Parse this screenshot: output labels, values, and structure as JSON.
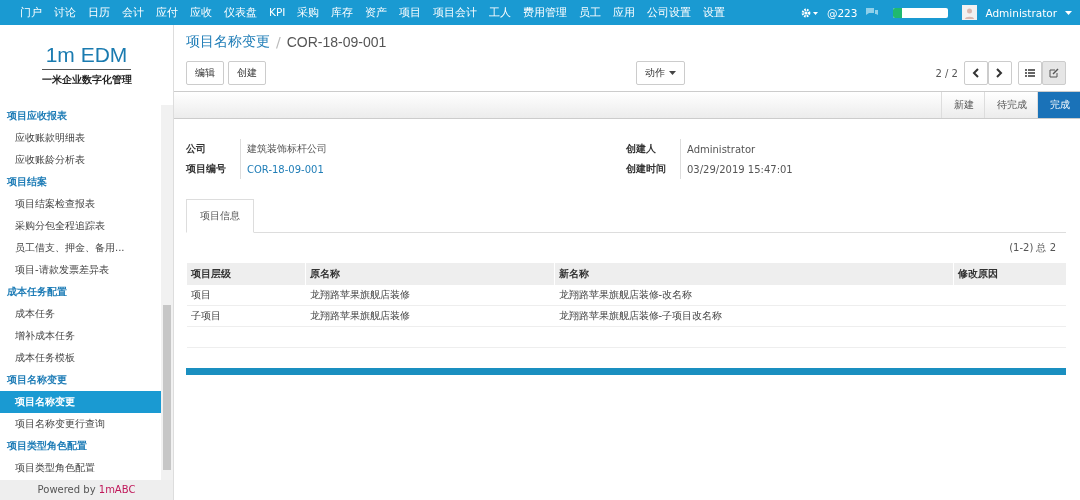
{
  "top_menu": [
    {
      "label": "门户"
    },
    {
      "label": "讨论"
    },
    {
      "label": "日历"
    },
    {
      "label": "会计"
    },
    {
      "label": "应付"
    },
    {
      "label": "应收"
    },
    {
      "label": "仪表盘"
    },
    {
      "label": "KPI"
    },
    {
      "label": "采购"
    },
    {
      "label": "库存"
    },
    {
      "label": "资产"
    },
    {
      "label": "项目"
    },
    {
      "label": "项目会计"
    },
    {
      "label": "工人"
    },
    {
      "label": "费用管理"
    },
    {
      "label": "员工"
    },
    {
      "label": "应用"
    },
    {
      "label": "公司设置"
    },
    {
      "label": "设置"
    }
  ],
  "top_right": {
    "mentions": "@223",
    "meter": {
      "level": 0.15
    },
    "user": "Administrator"
  },
  "logo": {
    "title": "1m EDM",
    "subtitle": "一米企业数字化管理"
  },
  "sidebar": [
    {
      "title": "项目应收报表",
      "items": [
        {
          "label": "应收账款明细表",
          "selected": false
        },
        {
          "label": "应收账龄分析表",
          "selected": false
        }
      ]
    },
    {
      "title": "项目结案",
      "items": [
        {
          "label": "项目结案检查报表",
          "selected": false
        },
        {
          "label": "采购分包全程追踪表",
          "selected": false
        },
        {
          "label": "员工借支、押金、备用...",
          "selected": false
        },
        {
          "label": "项目-请款发票差异表",
          "selected": false
        }
      ]
    },
    {
      "title": "成本任务配置",
      "items": [
        {
          "label": "成本任务",
          "selected": false
        },
        {
          "label": "增补成本任务",
          "selected": false
        },
        {
          "label": "成本任务模板",
          "selected": false
        }
      ]
    },
    {
      "title": "项目名称变更",
      "items": [
        {
          "label": "项目名称变更",
          "selected": true
        },
        {
          "label": "项目名称变更行查询",
          "selected": false
        }
      ]
    },
    {
      "title": "项目类型角色配置",
      "items": [
        {
          "label": "项目类型角色配置",
          "selected": false
        }
      ]
    }
  ],
  "powered_by": {
    "prefix": "Powered by",
    "brand": "1mABC"
  },
  "breadcrumb": {
    "parent": "项目名称变更",
    "separator": "/",
    "current": "COR-18-09-001"
  },
  "buttons": [
    "编辑",
    "创建"
  ],
  "action_menu": "动作",
  "pager": "2 / 2",
  "steps": [
    {
      "label": "新建",
      "selected": false
    },
    {
      "label": "待完成",
      "selected": false
    },
    {
      "label": "完成",
      "selected": true
    }
  ],
  "fields_left": [
    {
      "label": "公司",
      "value": "建筑装饰标杆公司",
      "link": false
    },
    {
      "label": "项目编号",
      "value": "COR-18-09-001",
      "link": true
    }
  ],
  "fields_right": [
    {
      "label": "创建人",
      "value": "Administrator",
      "link": false
    },
    {
      "label": "创建时间",
      "value": "03/29/2019 15:47:01",
      "link": false
    }
  ],
  "tabs": [
    {
      "label": "项目信息",
      "selected": true
    }
  ],
  "table": {
    "count": "(1-2) 总 2",
    "columns": [
      "项目层级",
      "原名称",
      "新名称",
      "修改原因"
    ],
    "rows": [
      [
        "项目",
        "龙翔路苹果旗舰店装修",
        "龙翔路苹果旗舰店装修-改名称",
        ""
      ],
      [
        "子项目",
        "龙翔路苹果旗舰店装修",
        "龙翔路苹果旗舰店装修-子项目改名称",
        ""
      ]
    ]
  }
}
